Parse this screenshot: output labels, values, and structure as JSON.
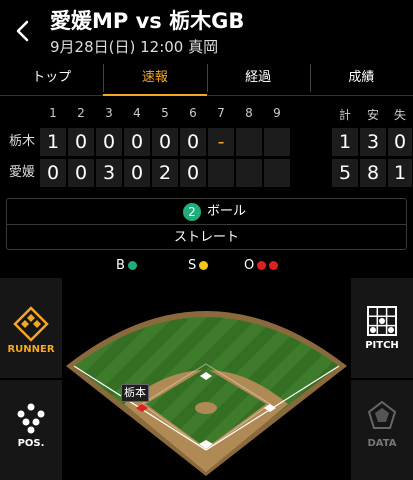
{
  "header": {
    "title": "愛媛MP vs 栃木GB",
    "subtitle": "9月28日(日) 12:00 真岡"
  },
  "tabs": [
    {
      "label": "トップ"
    },
    {
      "label": "速報"
    },
    {
      "label": "経過"
    },
    {
      "label": "成績"
    }
  ],
  "scoreboard": {
    "innings": [
      "1",
      "2",
      "3",
      "4",
      "5",
      "6",
      "7",
      "8",
      "9"
    ],
    "totals_headers": [
      "計",
      "安",
      "失"
    ],
    "rows": [
      {
        "team": "栃木",
        "innings": [
          "1",
          "0",
          "0",
          "0",
          "0",
          "0",
          "-",
          "",
          ""
        ],
        "totals": [
          "1",
          "3",
          "0"
        ]
      },
      {
        "team": "愛媛",
        "innings": [
          "0",
          "0",
          "3",
          "0",
          "2",
          "0",
          "",
          "",
          ""
        ],
        "totals": [
          "5",
          "8",
          "1"
        ]
      }
    ]
  },
  "count": {
    "balls_badge": "2",
    "balls_label": "ボール",
    "pitch_type": "ストレート"
  },
  "bso": {
    "b_label": "B",
    "s_label": "S",
    "o_label": "O",
    "b_color": "#1fae7a",
    "s_color": "#f5c518",
    "o_color": "#e02020"
  },
  "sidebar": {
    "runner_label": "RUNNER",
    "pos_label": "POS.",
    "pitch_label": "PITCH",
    "data_label": "DATA"
  },
  "field": {
    "runner_name": "栃本"
  }
}
